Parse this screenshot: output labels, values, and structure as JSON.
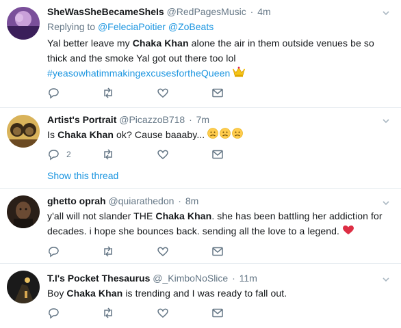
{
  "tweets": [
    {
      "display_name": "SheWasSheBecameSheIs",
      "handle": "@RedPagesMusic",
      "time": "4m",
      "replying_label": "Replying to",
      "mentions": [
        "@FeleciaPoitier",
        "@ZoBeats"
      ],
      "text_part1": "Yal better leave my ",
      "text_bold": "Chaka Khan",
      "text_part2": " alone the air in them outside venues be so thick and the smoke Yal got out there too lol",
      "hashtag": "#yeasowhatimmakingexcusesfortheQueen",
      "emoji": "crown",
      "reply_count": ""
    },
    {
      "display_name": "Artist's Portrait",
      "handle": "@PicazzoB718",
      "time": "7m",
      "text_part1": "Is ",
      "text_bold": "Chaka Khan",
      "text_part2": " ok? Cause baaaby... ",
      "emoji": "sad-face x3",
      "reply_count": "2",
      "show_thread": "Show this thread"
    },
    {
      "display_name": "ghetto oprah",
      "handle": "@quiarathedon",
      "time": "8m",
      "text_part1": "y'all will not slander THE ",
      "text_bold": "Chaka Khan",
      "text_part2": ". she has been battling her addiction for decades. i hope she bounces back. sending all the love to a legend. ",
      "emoji": "red-heart",
      "reply_count": ""
    },
    {
      "display_name": "T.I's Pocket Thesaurus",
      "handle": "@_KimboNoSlice",
      "time": "11m",
      "text_part1": "Boy ",
      "text_bold": "Chaka Khan",
      "text_part2": " is trending and I was ready to fall out.",
      "reply_count": ""
    }
  ],
  "separator": "·",
  "colors": {
    "link": "#1b95e0",
    "muted": "#657786",
    "text": "#14171a",
    "divider": "#e6ecf0",
    "heart": "#e0245e"
  }
}
